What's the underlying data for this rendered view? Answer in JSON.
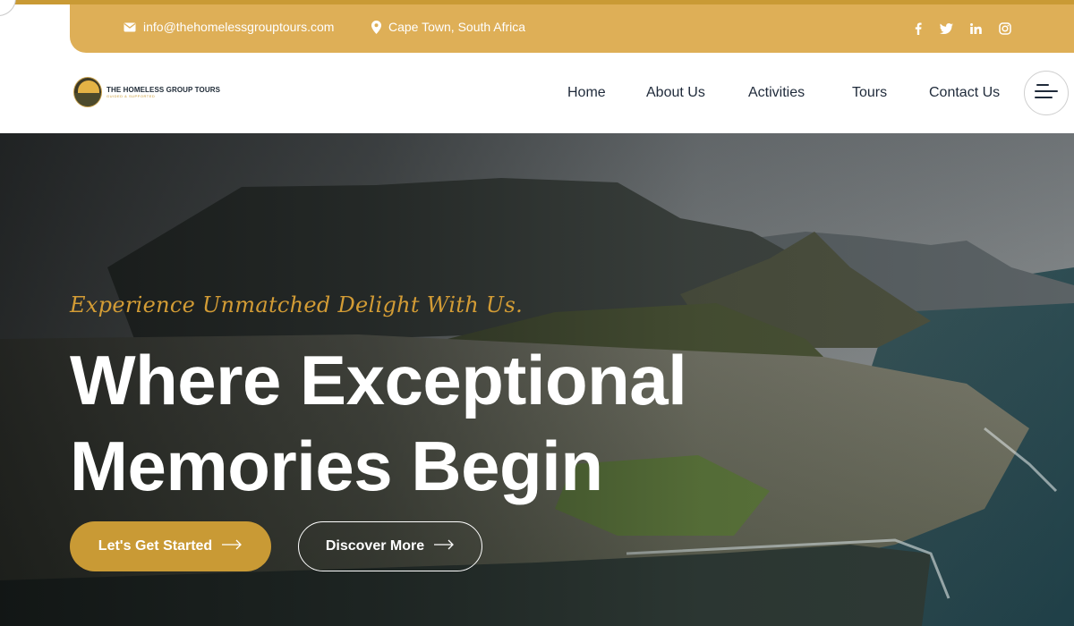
{
  "topbar": {
    "email": "info@thehomelessgrouptours.com",
    "location": "Cape Town, South Africa",
    "social_icons": [
      "facebook-icon",
      "twitter-icon",
      "linkedin-icon",
      "instagram-icon"
    ]
  },
  "brand": {
    "name": "THE HOMELESS GROUP TOURS",
    "tagline": "GUIDED & SUPPORTED"
  },
  "nav": {
    "items": [
      {
        "label": "Home"
      },
      {
        "label": "About Us"
      },
      {
        "label": "Activities"
      },
      {
        "label": "Tours"
      },
      {
        "label": "Contact Us"
      }
    ]
  },
  "hero": {
    "tagline": "Experience Unmatched Delight With Us.",
    "headline_line1": "Where Exceptional",
    "headline_line2": "Memories Begin",
    "primary_button": "Let's Get Started",
    "secondary_button": "Discover More"
  },
  "colors": {
    "accent": "#c99a35",
    "info_bar": "#deaf57",
    "nav_text": "#1f2a3a"
  }
}
